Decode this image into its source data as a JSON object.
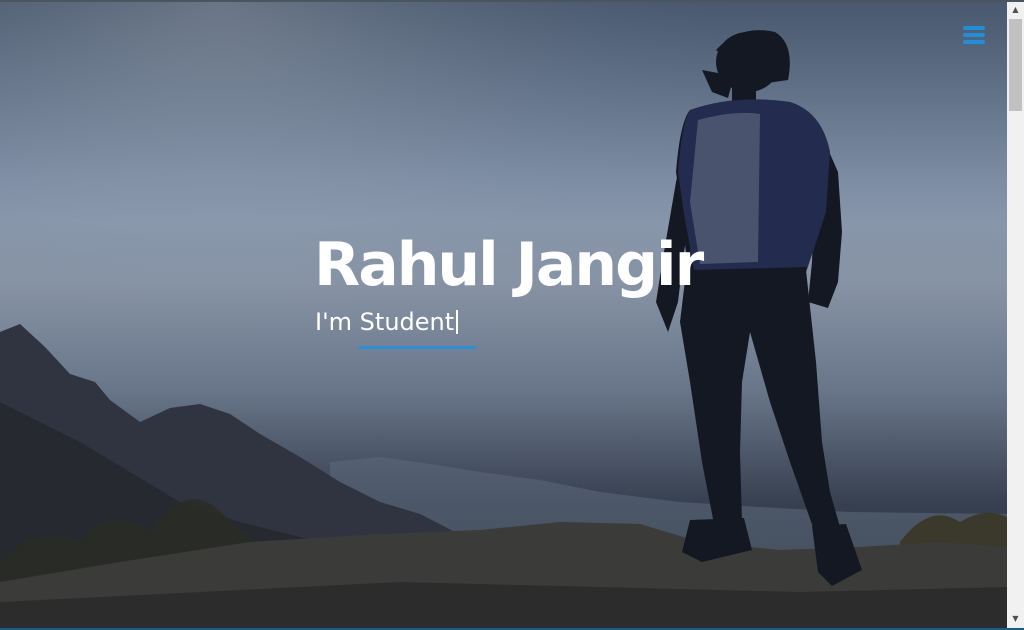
{
  "hero": {
    "name": "Rahul Jangir",
    "subtitle": "I'm Student"
  },
  "header": {
    "menu_icon": "hamburger-menu-icon"
  },
  "colors": {
    "accent": "#1e90d8",
    "text": "#ffffff"
  }
}
